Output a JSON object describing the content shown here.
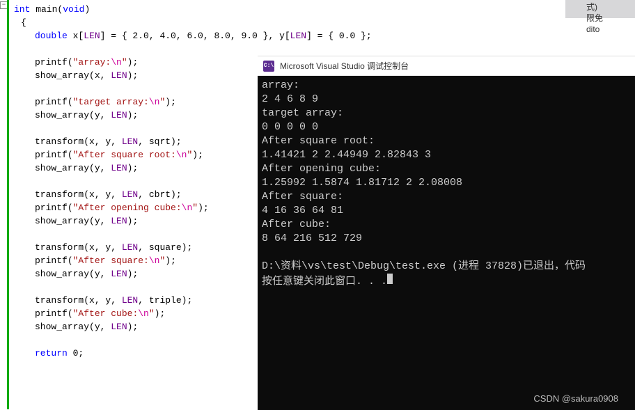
{
  "editor": {
    "sig_int": "int",
    "sig_main": " main",
    "sig_void": "void",
    "l2": "{",
    "decl_double": "double",
    "decl_part1": " x[",
    "decl_LEN": "LEN",
    "decl_part2": "] = { 2.0, 4.0, 6.0, 8.0, 9.0 }, y[",
    "decl_part3": "] = { 0.0 };",
    "printf": "printf",
    "show_array": "show_array",
    "transform": "transform",
    "open_p": "(",
    "close_p": ")",
    "semi": ";",
    "str_array_pre": "\"array:",
    "esc_n": "\\n",
    "str_close": "\"",
    "show_x": "(x, ",
    "show_y": "(y, ",
    "str_target_pre": "\"target array:",
    "tr_args_pre": "(x, y, ",
    "tr_sqrt": ", sqrt)",
    "tr_cbrt": ", cbrt)",
    "tr_square": ", square)",
    "tr_triple": ", triple)",
    "str_sqrt_pre": "\"After square root:",
    "str_cube_open_pre": "\"After opening cube:",
    "str_square_pre": "\"After square:",
    "str_cube_pre": "\"After cube:",
    "return_kw": "return",
    "return_val": " 0"
  },
  "console": {
    "title": "Microsoft Visual Studio 调试控制台",
    "l1": "array:",
    "l2": "2 4 6 8 9",
    "l3": "target array:",
    "l4": "0 0 0 0 0",
    "l5": "After square root:",
    "l6": "1.41421 2 2.44949 2.82843 3",
    "l7": "After opening cube:",
    "l8": "1.25992 1.5874 1.81712 2 2.08008",
    "l9": "After square:",
    "l10": "4 16 36 64 81",
    "l11": "After cube:",
    "l12": "8 64 216 512 729",
    "l13": "",
    "l14": "D:\\资料\\vs\\test\\Debug\\test.exe (进程 37828)已退出，代码",
    "l15": "按任意键关闭此窗口. . ."
  },
  "right": {
    "r1": "式)",
    "r2": "限免",
    "r3": "dito"
  },
  "watermark": "CSDN @sakura0908"
}
